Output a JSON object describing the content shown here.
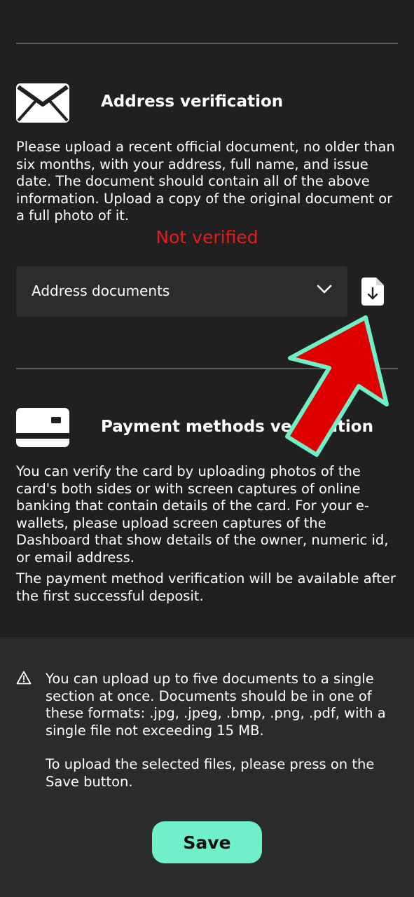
{
  "address_section": {
    "icon": "envelope-icon",
    "title": "Address verification",
    "description": "Please upload a recent official document, no older than six months, with your address, full name, and issue date. The document should contain all of the above information. Upload a copy of the original document or a full photo of it.",
    "status": "Not verified",
    "status_color": "#e11d1d",
    "document_select": {
      "value": "Address documents"
    },
    "upload_icon": "file-download-icon"
  },
  "payment_section": {
    "icon": "credit-card-icon",
    "title": "Payment methods verification",
    "description": "You can verify the card by uploading photos of the card's both sides or with screen captures of online banking that contain details of the card. For your e-wallets, please upload screen captures of the Dashboard that show details of the owner, numeric id, or email address.",
    "availability_note": "The payment method verification will be available after the first successful deposit."
  },
  "upload_notice": {
    "icon": "warning-icon",
    "text": "You can upload up to five documents to a single section at once. Documents should be in one of these formats: .jpg, .jpeg, .bmp, .png, .pdf, with a single file not exceeding 15 MB.",
    "save_hint": "To upload the selected files, please press on the Save button."
  },
  "save_button": {
    "label": "Save",
    "color": "#6ff0c8"
  },
  "overlay": {
    "icon": "pointer-arrow-icon",
    "color": "#e00000",
    "outline_color": "#6ff0c8"
  }
}
